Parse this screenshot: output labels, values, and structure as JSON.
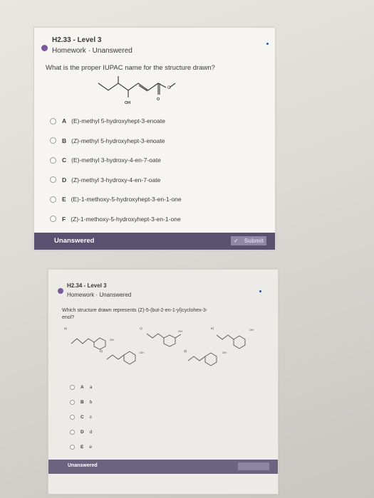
{
  "q1": {
    "title": "H2.33 - Level 3",
    "subtitle": "Homework · Unanswered",
    "question": "What is the proper IUPAC name for the structure drawn?",
    "structure_labels": {
      "oh": "OH",
      "o": "O"
    },
    "options": [
      {
        "letter": "A",
        "text": "(E)-methyl 5-hydroxyhept-3-enoate"
      },
      {
        "letter": "B",
        "text": "(Z)-methyl 5-hydroxyhept-3-enoate"
      },
      {
        "letter": "C",
        "text": "(E)-methyl 3-hydroxy-4-en-7-oate"
      },
      {
        "letter": "D",
        "text": "(Z)-methyl 3-hydroxy-4-en-7-oate"
      },
      {
        "letter": "E",
        "text": "(E)-1-methoxy-5-hydroxyhept-3-en-1-one"
      },
      {
        "letter": "F",
        "text": "(Z)-1-methoxy-5-hydroxyhept-3-en-1-one"
      }
    ],
    "status": "Unanswered",
    "submit": "Submit"
  },
  "q2": {
    "title": "H2.34 - Level 3",
    "subtitle": "Homework · Unanswered",
    "question_line1": "Which structure drawn represents (Z)-5-(but-2-en-1-yl)cyclohex-3-",
    "question_line2": "enol?",
    "structure_tags": [
      "a)",
      "c)",
      "e)",
      "b)",
      "d)"
    ],
    "oh": "OH",
    "options": [
      {
        "letter": "A",
        "text": "a"
      },
      {
        "letter": "B",
        "text": "b"
      },
      {
        "letter": "C",
        "text": "c"
      },
      {
        "letter": "D",
        "text": "d"
      },
      {
        "letter": "E",
        "text": "e"
      }
    ],
    "status": "Unanswered"
  },
  "colors": {
    "accent": "#5a5170",
    "bullet": "#7a5a9a",
    "blue_dot": "#2a55a8"
  }
}
